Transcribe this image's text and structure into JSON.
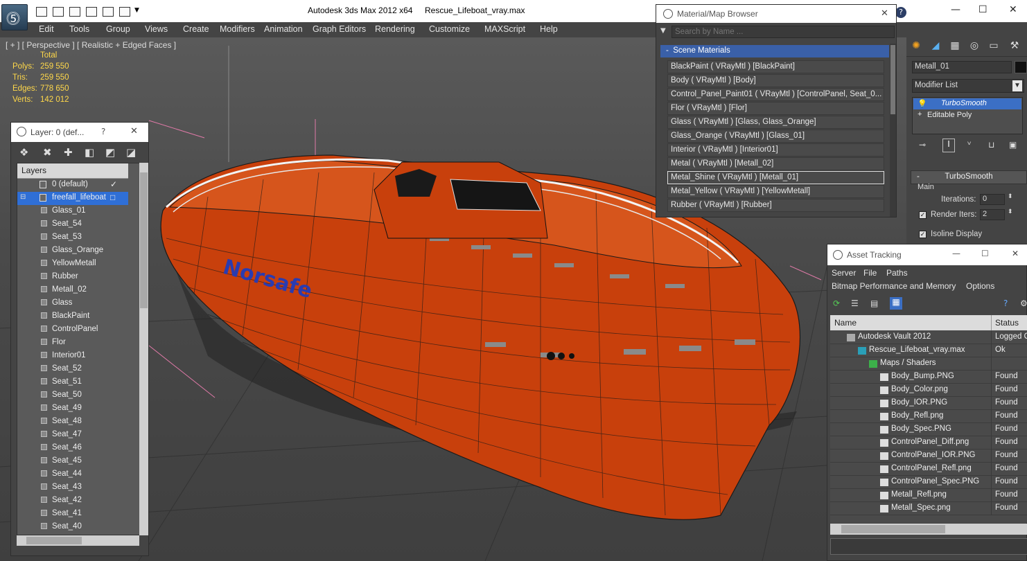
{
  "app": {
    "title": "Autodesk 3ds Max  2012 x64",
    "file": "Rescue_Lifeboat_vray.max",
    "logo": "3ds-max-logo",
    "help_icon": "help-icon"
  },
  "menu": [
    "Edit",
    "Tools",
    "Group",
    "Views",
    "Create",
    "Modifiers",
    "Animation",
    "Graph Editors",
    "Rendering",
    "Customize",
    "MAXScript",
    "Help"
  ],
  "viewport": {
    "label": "[ + ] [ Perspective ] [ Realistic + Edged Faces ]",
    "stats_header": "Total",
    "stats": [
      {
        "label": "Polys:",
        "value": "259 550"
      },
      {
        "label": "Tris:",
        "value": "259 550"
      },
      {
        "label": "Edges:",
        "value": "778 650"
      },
      {
        "label": "Verts:",
        "value": "142 012"
      }
    ],
    "boat_text": "Norsafe"
  },
  "layer_dialog": {
    "title": "Layer: 0 (def...",
    "help": "?",
    "header": "Layers",
    "rows": [
      {
        "name": "0 (default)",
        "type": "layer",
        "selected": false
      },
      {
        "name": "freefall_lifeboat",
        "type": "layer",
        "selected": true
      },
      {
        "name": "Glass_01",
        "type": "child"
      },
      {
        "name": "Seat_54",
        "type": "child"
      },
      {
        "name": "Seat_53",
        "type": "child"
      },
      {
        "name": "Glass_Orange",
        "type": "child"
      },
      {
        "name": "YellowMetall",
        "type": "child"
      },
      {
        "name": "Rubber",
        "type": "child"
      },
      {
        "name": "Metall_02",
        "type": "child"
      },
      {
        "name": "Glass",
        "type": "child"
      },
      {
        "name": "BlackPaint",
        "type": "child"
      },
      {
        "name": "ControlPanel",
        "type": "child"
      },
      {
        "name": "Flor",
        "type": "child"
      },
      {
        "name": "Interior01",
        "type": "child"
      },
      {
        "name": "Seat_52",
        "type": "child"
      },
      {
        "name": "Seat_51",
        "type": "child"
      },
      {
        "name": "Seat_50",
        "type": "child"
      },
      {
        "name": "Seat_49",
        "type": "child"
      },
      {
        "name": "Seat_48",
        "type": "child"
      },
      {
        "name": "Seat_47",
        "type": "child"
      },
      {
        "name": "Seat_46",
        "type": "child"
      },
      {
        "name": "Seat_45",
        "type": "child"
      },
      {
        "name": "Seat_44",
        "type": "child"
      },
      {
        "name": "Seat_43",
        "type": "child"
      },
      {
        "name": "Seat_42",
        "type": "child"
      },
      {
        "name": "Seat_41",
        "type": "child"
      },
      {
        "name": "Seat_40",
        "type": "child"
      }
    ]
  },
  "material_browser": {
    "title": "Material/Map Browser",
    "search_placeholder": "Search by Name ...",
    "group": "Scene Materials",
    "items": [
      "BlackPaint  ( VRayMtl ) [BlackPaint]",
      "Body  ( VRayMtl ) [Body]",
      "Control_Panel_Paint01  ( VRayMtl ) [ControlPanel, Seat_0...",
      "Flor  ( VRayMtl ) [Flor]",
      "Glass  ( VRayMtl ) [Glass, Glass_Orange]",
      "Glass_Orange  ( VRayMtl ) [Glass_01]",
      "Interior  ( VRayMtl ) [Interior01]",
      "Metal  ( VRayMtl ) [Metall_02]",
      "Metal_Shine  ( VRayMtl ) [Metall_01]",
      "Metal_Yellow  ( VRayMtl ) [YellowMetall]",
      "Rubber  ( VRayMtl ) [Rubber]"
    ],
    "selected_index": 8
  },
  "command_panel": {
    "object_name": "Metall_01",
    "modifier_list": "Modifier List",
    "stack": [
      "TurboSmooth",
      "Editable Poly"
    ],
    "rollout": "TurboSmooth",
    "main_label": "Main",
    "iterations_label": "Iterations:",
    "iterations_value": "0",
    "render_iters_label": "Render Iters:",
    "render_iters_value": "2",
    "isoline_label": "Isoline Display"
  },
  "asset_tracking": {
    "title": "Asset Tracking",
    "menu_row1": [
      "Server",
      "File",
      "Paths"
    ],
    "menu_row2": [
      "Bitmap Performance and Memory",
      "Options"
    ],
    "col_name": "Name",
    "col_status": "Status",
    "rows": [
      {
        "name": "Autodesk Vault 2012",
        "status": "Logged O",
        "indent": 0,
        "icon": "vault-icon"
      },
      {
        "name": "Rescue_Lifeboat_vray.max",
        "status": "Ok",
        "indent": 1,
        "icon": "max-file-icon"
      },
      {
        "name": "Maps / Shaders",
        "status": "",
        "indent": 2,
        "icon": "maps-icon"
      },
      {
        "name": "Body_Bump.PNG",
        "status": "Found",
        "indent": 3,
        "icon": "png-icon"
      },
      {
        "name": "Body_Color.png",
        "status": "Found",
        "indent": 3,
        "icon": "png-icon"
      },
      {
        "name": "Body_IOR.PNG",
        "status": "Found",
        "indent": 3,
        "icon": "png-icon"
      },
      {
        "name": "Body_Refl.png",
        "status": "Found",
        "indent": 3,
        "icon": "png-icon"
      },
      {
        "name": "Body_Spec.PNG",
        "status": "Found",
        "indent": 3,
        "icon": "png-icon"
      },
      {
        "name": "ControlPanel_Diff.png",
        "status": "Found",
        "indent": 3,
        "icon": "png-icon"
      },
      {
        "name": "ControlPanel_IOR.PNG",
        "status": "Found",
        "indent": 3,
        "icon": "png-icon"
      },
      {
        "name": "ControlPanel_Refl.png",
        "status": "Found",
        "indent": 3,
        "icon": "png-icon"
      },
      {
        "name": "ControlPanel_Spec.PNG",
        "status": "Found",
        "indent": 3,
        "icon": "png-icon"
      },
      {
        "name": "Metall_Refl.png",
        "status": "Found",
        "indent": 3,
        "icon": "png-icon"
      },
      {
        "name": "Metall_Spec.png",
        "status": "Found",
        "indent": 3,
        "icon": "png-icon"
      }
    ]
  },
  "colors": {
    "hull": "#c8400c",
    "selection": "#2f6fd6",
    "stats_text": "#ffd84a"
  }
}
